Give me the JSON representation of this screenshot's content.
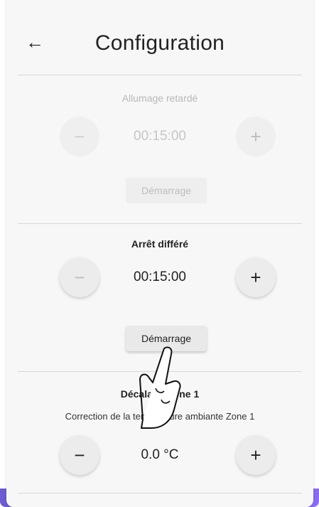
{
  "header": {
    "back_icon": "arrow-left-icon",
    "title": "Configuration"
  },
  "delayed_start": {
    "title": "Allumage retardé",
    "value": "00:15:00",
    "minus": "−",
    "plus": "+",
    "start_label": "Démarrage"
  },
  "delayed_stop": {
    "title": "Arrêt différé",
    "value": "00:15:00",
    "minus": "−",
    "plus": "+",
    "start_label": "Démarrage"
  },
  "offset_zone1": {
    "title": "Décalage Zone 1",
    "subtitle": "Correction de la température ambiante Zone 1",
    "value": "0.0 °C",
    "minus": "−",
    "plus": "+"
  },
  "colors": {
    "accent": "#7a63e0",
    "background": "#f7f7f7"
  }
}
